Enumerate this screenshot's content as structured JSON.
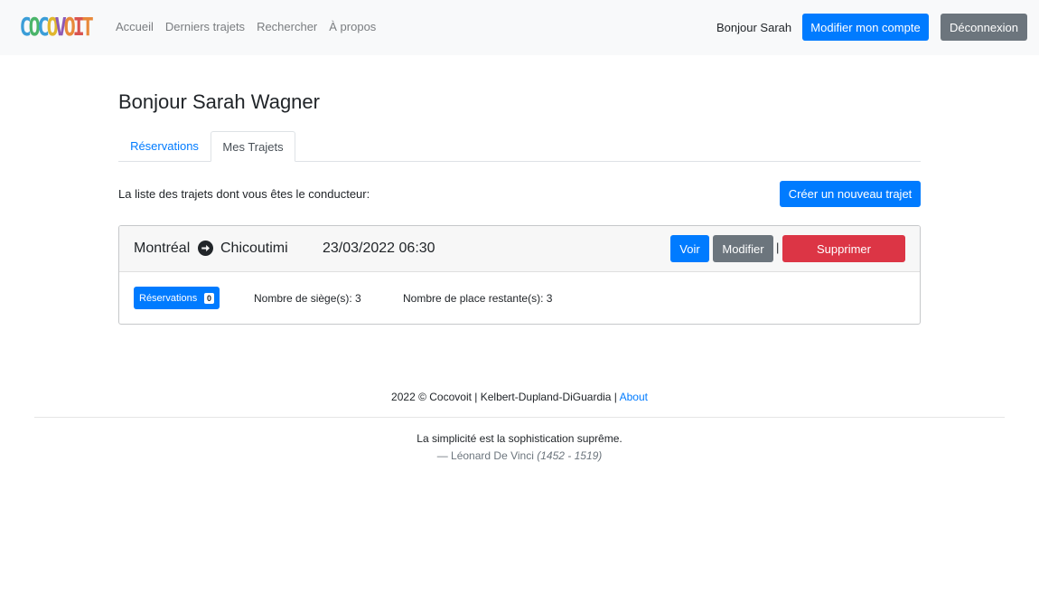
{
  "navbar": {
    "logo_letters": [
      {
        "char": "C",
        "color": "#3b9ed8"
      },
      {
        "char": "O",
        "color": "#4bb56a"
      },
      {
        "char": "C",
        "color": "#3b9ed8"
      },
      {
        "char": "O",
        "color": "#e0b72e"
      },
      {
        "char": "V",
        "color": "#8e5ab5"
      },
      {
        "char": "O",
        "color": "#e8893a"
      },
      {
        "char": "I",
        "color": "#d9534f"
      },
      {
        "char": "T",
        "color": "#e8893a"
      }
    ],
    "links": [
      "Accueil",
      "Derniers trajets",
      "Rechercher",
      "À propos"
    ],
    "greeting": "Bonjour Sarah",
    "account_button": "Modifier mon compte",
    "logout_button": "Déconnexion"
  },
  "page": {
    "title": "Bonjour Sarah Wagner",
    "tabs": [
      "Réservations",
      "Mes Trajets"
    ],
    "active_tab": "Mes Trajets",
    "list_intro": "La liste des trajets dont vous êtes le conducteur:",
    "create_button": "Créer un nouveau trajet"
  },
  "trip": {
    "from": "Montréal",
    "to": "Chicoutimi",
    "datetime": "23/03/2022 06:30",
    "view_button": "Voir",
    "edit_button": "Modifier",
    "separator": "|",
    "delete_button": "Supprimer",
    "reservations_label": "Réservations",
    "reservations_count": "0",
    "seats_text": "Nombre de siège(s): 3",
    "remaining_text": "Nombre de place restante(s): 3"
  },
  "footer": {
    "copyright": "2022 © Cocovoit | Kelbert-Dupland-DiGuardia |",
    "about_link": "About",
    "quote": "La simplicité est la sophistication suprême.",
    "quote_author": "— Léonard De Vinci",
    "quote_years": "(1452 - 1519)"
  },
  "colors": {
    "primary": "#007bff",
    "secondary": "#6c757d",
    "danger": "#dc3545",
    "navbar_bg": "#f8f9fa"
  }
}
